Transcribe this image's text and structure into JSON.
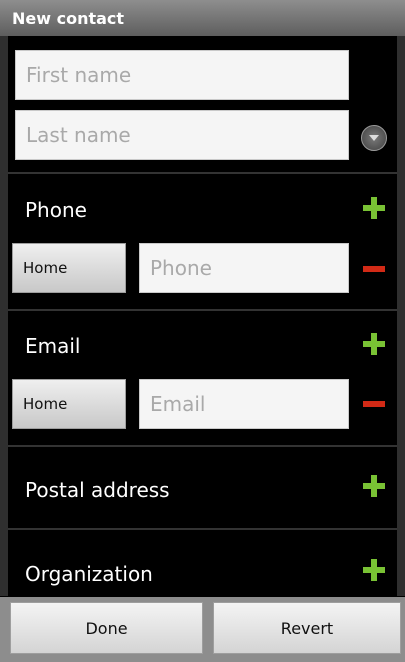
{
  "title": "New contact",
  "name": {
    "first_placeholder": "First name",
    "last_placeholder": "Last name"
  },
  "phone": {
    "label": "Phone",
    "type": "Home",
    "placeholder": "Phone"
  },
  "email": {
    "label": "Email",
    "type": "Home",
    "placeholder": "Email"
  },
  "postal": {
    "label": "Postal address"
  },
  "organization": {
    "label": "Organization"
  },
  "actions": {
    "done": "Done",
    "revert": "Revert"
  },
  "colors": {
    "accent_add": "#79c234",
    "accent_remove": "#d22a16"
  },
  "icons": {
    "add": "plus-icon",
    "remove": "minus-icon",
    "expand": "chevron-down-icon"
  }
}
